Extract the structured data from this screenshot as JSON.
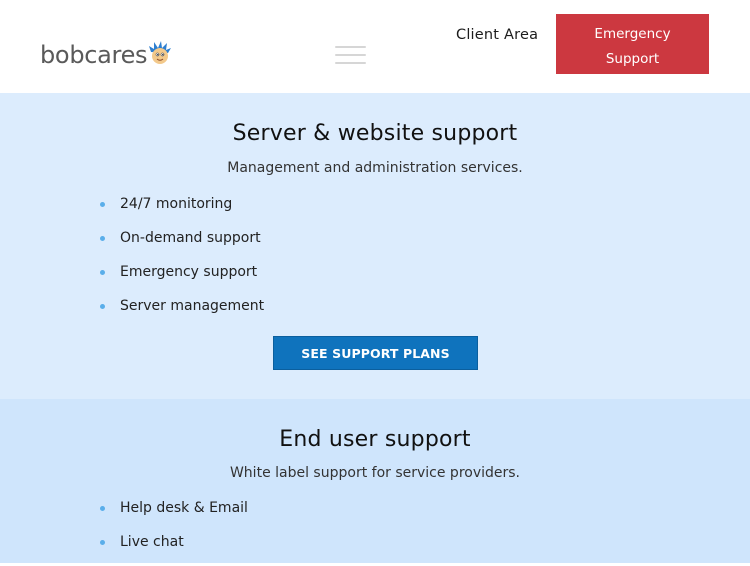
{
  "header": {
    "logo_text": "bobcares",
    "client_area_label": "Client Area",
    "emergency_line1": "Emergency",
    "emergency_line2": "Support"
  },
  "colors": {
    "accent_red": "#cc3840",
    "accent_blue": "#0f73bd",
    "section_bg_1": "#dcecfd",
    "section_bg_2": "#cfe5fc",
    "bullet": "#5aaeea"
  },
  "icons": {
    "logo": "bobcares-mascot-icon",
    "menu": "hamburger-menu-icon"
  },
  "server_support": {
    "title": "Server & website support",
    "subtitle": "Management and administration services.",
    "items": [
      "24/7 monitoring",
      "On-demand support",
      "Emergency support",
      "Server management"
    ],
    "cta_label": "SEE SUPPORT PLANS"
  },
  "end_user_support": {
    "title": "End user support",
    "subtitle": "White label support for service providers.",
    "items": [
      "Help desk & Email",
      "Live chat"
    ]
  }
}
